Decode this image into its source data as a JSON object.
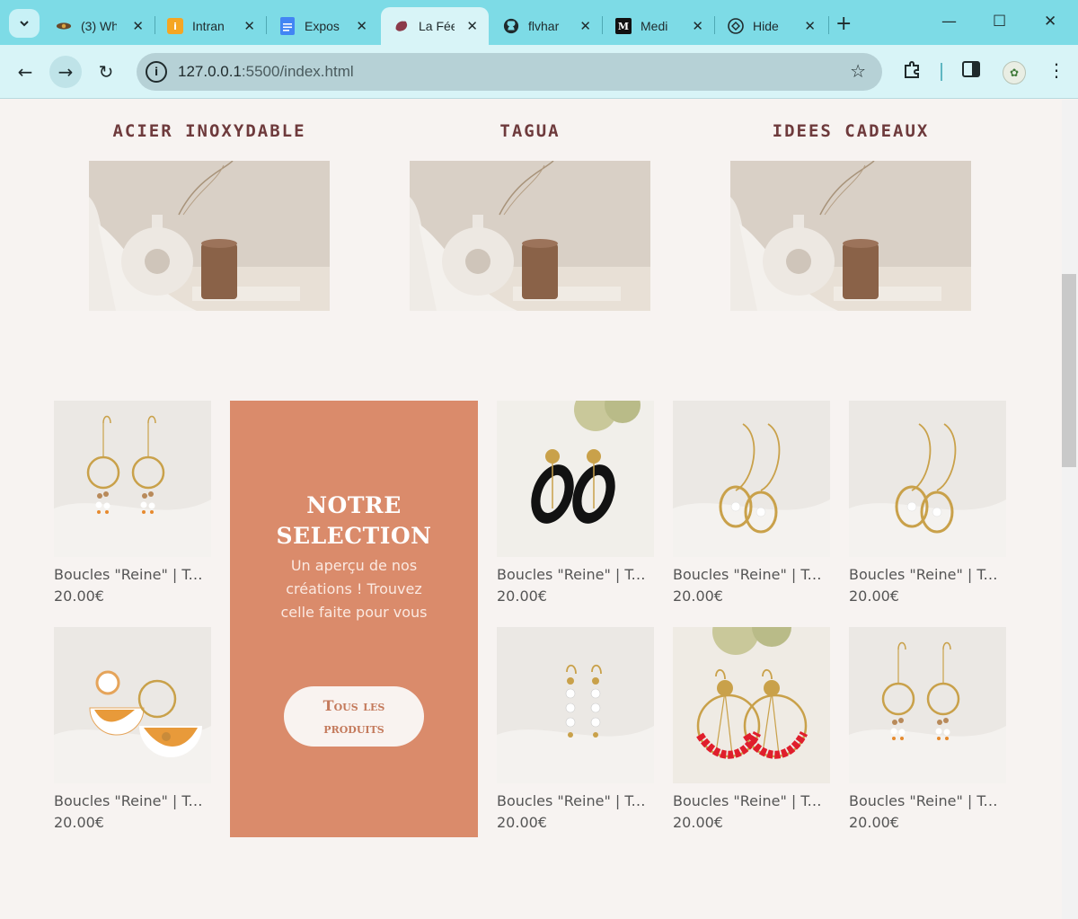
{
  "browser": {
    "tabs": [
      {
        "title": "(3) Wh",
        "icon": "eye-logo-icon",
        "active": false
      },
      {
        "title": "Intran",
        "icon": "intranet-logo-icon",
        "active": false
      },
      {
        "title": "Expos",
        "icon": "google-docs-icon",
        "active": false
      },
      {
        "title": "La Fée",
        "icon": "fairy-logo-icon",
        "active": true
      },
      {
        "title": "flvhar",
        "icon": "github-icon",
        "active": false
      },
      {
        "title": "Medi",
        "icon": "medium-icon",
        "active": false
      },
      {
        "title": "Hide",
        "icon": "chatgpt-icon",
        "active": false
      }
    ],
    "url_host": "127.0.0.1",
    "url_rest": ":5500/index.html"
  },
  "categories": [
    {
      "title": "ACIER INOXYDABLE"
    },
    {
      "title": "TAGUA"
    },
    {
      "title": "IDEES CADEAUX"
    }
  ],
  "products": [
    {
      "name": "Boucles \"Reine\" | Tagua",
      "price": "20.00€",
      "style": "hoop-pearls"
    },
    {
      "name": "Boucles \"Reine\" | Tagua",
      "price": "20.00€",
      "style": "black-oval"
    },
    {
      "name": "Boucles \"Reine\" | Tagua",
      "price": "20.00€",
      "style": "gold-drop"
    },
    {
      "name": "Boucles \"Reine\" | Tagua",
      "price": "20.00€",
      "style": "gold-drop"
    },
    {
      "name": "Boucles \"Reine\" | Tagua",
      "price": "20.00€",
      "style": "floral-half"
    },
    {
      "name": "Boucles \"Reine\" | Tagua",
      "price": "20.00€",
      "style": "pearl-chain"
    },
    {
      "name": "Boucles \"Reine\" | Tagua",
      "price": "20.00€",
      "style": "red-fan"
    },
    {
      "name": "Boucles \"Reine\" | Tagua",
      "price": "20.00€",
      "style": "hoop-pearls"
    }
  ],
  "promo": {
    "title_line1": "NOTRE",
    "title_line2": "SELECTION",
    "subtitle": "Un aperçu de nos créations ! Trouvez celle faite pour vous",
    "button": "Tous les produits"
  },
  "colors": {
    "accent": "#da8b6b",
    "heading": "#6e3a3c",
    "background": "#f7f3f1"
  }
}
